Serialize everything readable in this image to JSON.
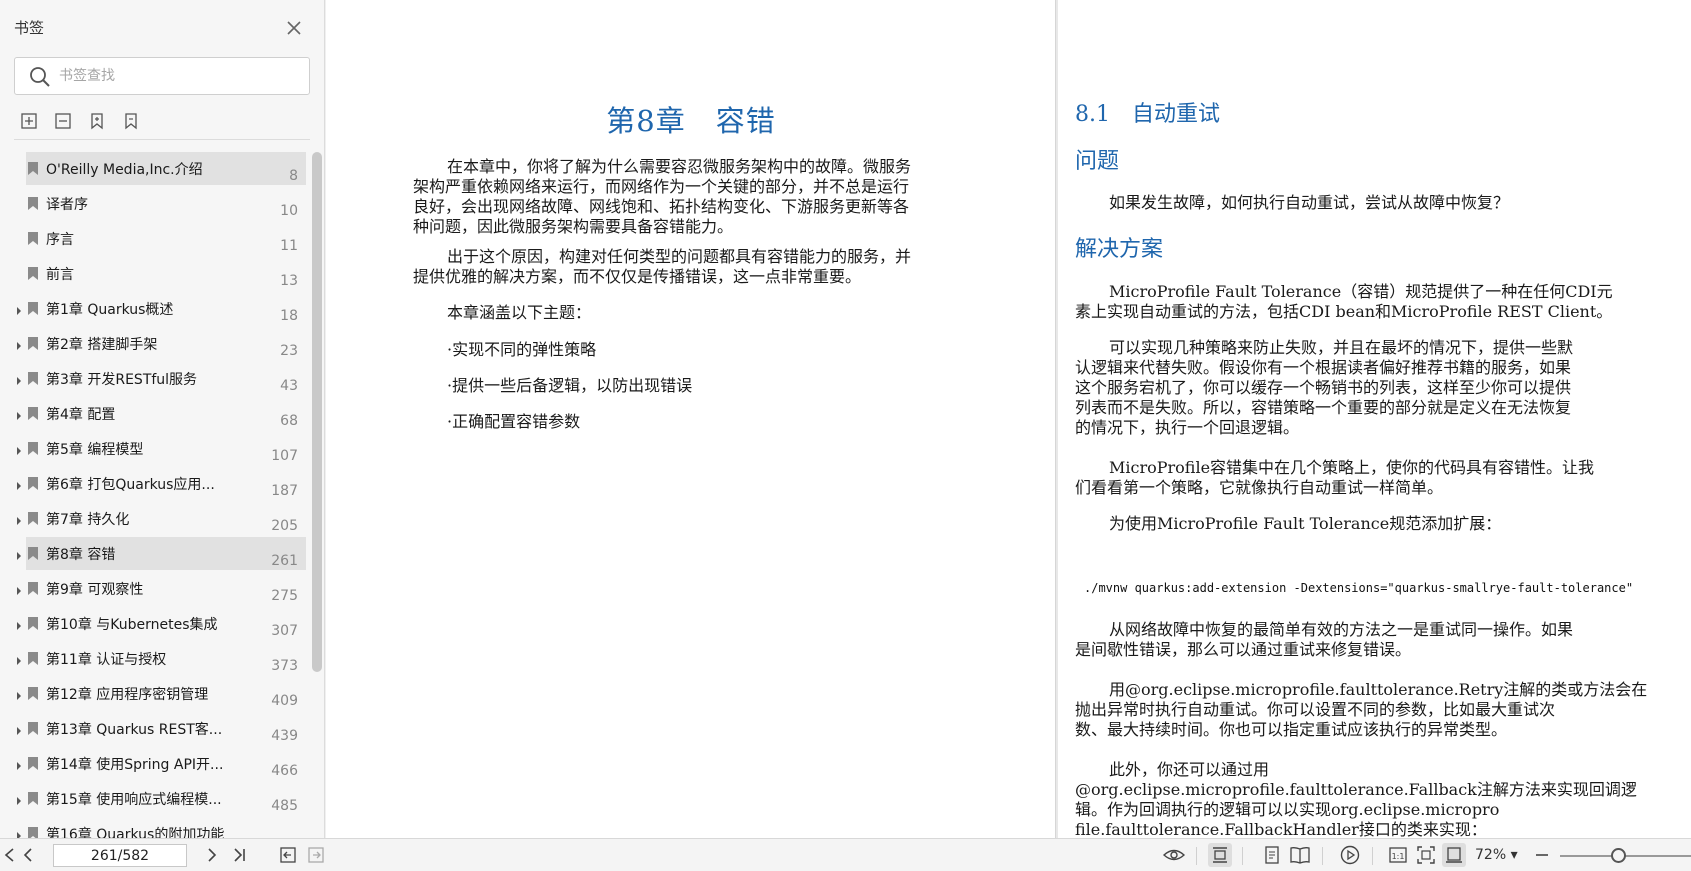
{
  "sidebar": {
    "title": "书签",
    "search_placeholder": "书签查找",
    "items": [
      {
        "label": "O'Reilly Media,Inc.介绍",
        "page": "8",
        "expandable": false,
        "selected": true
      },
      {
        "label": "译者序",
        "page": "10",
        "expandable": false,
        "selected": false
      },
      {
        "label": "序言",
        "page": "11",
        "expandable": false,
        "selected": false
      },
      {
        "label": "前言",
        "page": "13",
        "expandable": false,
        "selected": false
      },
      {
        "label": "第1章 Quarkus概述",
        "page": "18",
        "expandable": true,
        "selected": false
      },
      {
        "label": "第2章 搭建脚手架",
        "page": "23",
        "expandable": true,
        "selected": false
      },
      {
        "label": "第3章 开发RESTful服务",
        "page": "43",
        "expandable": true,
        "selected": false
      },
      {
        "label": "第4章 配置",
        "page": "68",
        "expandable": true,
        "selected": false
      },
      {
        "label": "第5章 编程模型",
        "page": "107",
        "expandable": true,
        "selected": false
      },
      {
        "label": "第6章 打包Quarkus应用...",
        "page": "187",
        "expandable": true,
        "selected": false
      },
      {
        "label": "第7章 持久化",
        "page": "205",
        "expandable": true,
        "selected": false
      },
      {
        "label": "第8章 容错",
        "page": "261",
        "expandable": true,
        "selected": true
      },
      {
        "label": "第9章 可观察性",
        "page": "275",
        "expandable": true,
        "selected": false
      },
      {
        "label": "第10章 与Kubernetes集成",
        "page": "307",
        "expandable": true,
        "selected": false
      },
      {
        "label": "第11章 认证与授权",
        "page": "373",
        "expandable": true,
        "selected": false
      },
      {
        "label": "第12章 应用程序密钥管理",
        "page": "409",
        "expandable": true,
        "selected": false
      },
      {
        "label": "第13章 Quarkus REST客...",
        "page": "439",
        "expandable": true,
        "selected": false
      },
      {
        "label": "第14章 使用Spring API开...",
        "page": "466",
        "expandable": true,
        "selected": false
      },
      {
        "label": "第15章 使用响应式编程模...",
        "page": "485",
        "expandable": true,
        "selected": false
      },
      {
        "label": "第16章 Quarkus的附加功能",
        "page": "",
        "expandable": true,
        "selected": false
      }
    ]
  },
  "left_page": {
    "chapter_title": "第8章　容错",
    "p1_lines": [
      "在本章中，你将了解为什么需要容忍微服务架构中的故障。微服务",
      "架构严重依赖网络来运行，而网络作为一个关键的部分，并不总是运行",
      "良好，会出现网络故障、网线饱和、拓扑结构变化、下游服务更新等各",
      "种问题，因此微服务架构需要具备容错能力。"
    ],
    "p2_lines": [
      "出于这个原因，构建对任何类型的问题都具有容错能力的服务，并",
      "提供优雅的解决方案，而不仅仅是传播错误，这一点非常重要。"
    ],
    "p3": "本章涵盖以下主题：",
    "bullets": [
      "·实现不同的弹性策略",
      "·提供一些后备逻辑，以防出现错误",
      "·正确配置容错参数"
    ]
  },
  "right_page": {
    "section_title": "8.1　自动重试",
    "problem_heading": "问题",
    "problem_text": "如果发生故障，如何执行自动重试，尝试从故障中恢复？",
    "solution_heading": "解决方案",
    "s1": [
      "MicroProfile Fault Tolerance（容错）规范提供了一种在任何CDI元",
      "素上实现自动重试的方法，包括CDI bean和MicroProfile REST Client。"
    ],
    "s2": [
      "可以实现几种策略来防止失败，并且在最坏的情况下，提供一些默",
      "认逻辑来代替失败。假设你有一个根据读者偏好推荐书籍的服务，如果",
      "这个服务宕机了，你可以缓存一个畅销书的列表，这样至少你可以提供",
      "列表而不是失败。所以，容错策略一个重要的部分就是定义在无法恢复",
      "的情况下，执行一个回退逻辑。"
    ],
    "s3": [
      "MicroProfile容错集中在几个策略上，使你的代码具有容错性。让我",
      "们看看第一个策略，它就像执行自动重试一样简单。"
    ],
    "s4": "为使用MicroProfile Fault Tolerance规范添加扩展：",
    "code": "./mvnw quarkus:add-extension -Dextensions=\"quarkus-smallrye-fault-tolerance\"",
    "s5": [
      "从网络故障中恢复的最简单有效的方法之一是重试同一操作。如果",
      "是间歇性错误，那么可以通过重试来修复错误。"
    ],
    "s6": [
      "用@org.eclipse.microprofile.faulttolerance.Retry注解的类或方法会在",
      "抛出异常时执行自动重试。你可以设置不同的参数，比如最大重试次",
      "数、最大持续时间。你也可以指定重试应该执行的异常类型。"
    ],
    "s7": [
      "此外，你还可以通过用",
      "@org.eclipse.microprofile.faulttolerance.Fallback注解方法来实现回调逻",
      "辑。作为回调执行的逻辑可以以实现org.eclipse.micropro",
      "file.faulttolerance.FallbackHandler接口的类来实现："
    ]
  },
  "toolbar": {
    "page_indicator": "261/582",
    "zoom": "72%",
    "zoom_fraction": 0.45
  },
  "colors": {
    "accent": "#1f66ad",
    "selected_bg": "#e1e1e1"
  }
}
